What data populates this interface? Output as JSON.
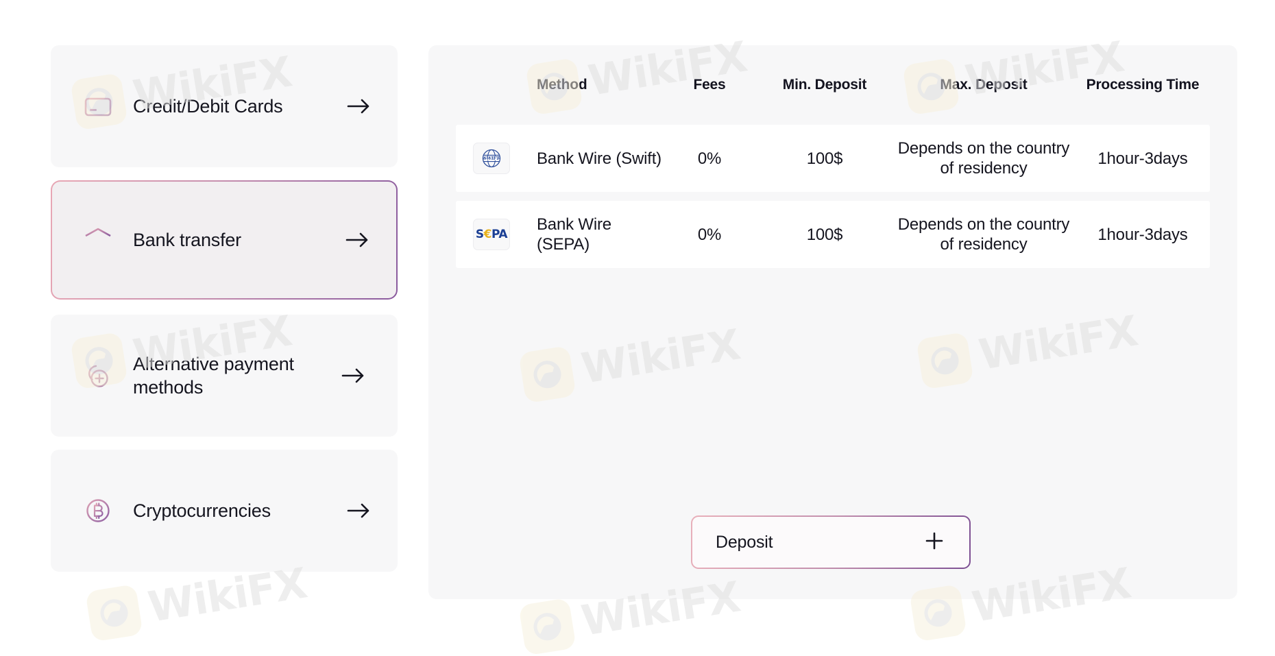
{
  "sidebar": {
    "items": [
      {
        "label": "Credit/Debit Cards",
        "icon": "credit-card-icon",
        "selected": false,
        "arrow": "→"
      },
      {
        "label": "Bank transfer",
        "icon": "bank-icon",
        "selected": true,
        "arrow": "→"
      },
      {
        "label": "Alternative payment methods",
        "icon": "alternative-payment-icon",
        "selected": false,
        "arrow": "→"
      },
      {
        "label": "Cryptocurrencies",
        "icon": "bitcoin-icon",
        "selected": false,
        "arrow": "→"
      }
    ]
  },
  "table": {
    "headers": {
      "logo": "",
      "method": "Method",
      "fees": "Fees",
      "min_deposit": "Min. Deposit",
      "max_deposit": "Max. Deposit",
      "processing_time": "Processing Time"
    },
    "rows": [
      {
        "logo": "swift-logo-icon",
        "logo_text": "SWIFT",
        "method": "Bank Wire (Swift)",
        "fees": "0%",
        "min_deposit": "100$",
        "max_deposit": "Depends on the country of residency",
        "processing_time": "1hour-3days"
      },
      {
        "logo": "sepa-logo-icon",
        "logo_text": "SEPA",
        "method": "Bank Wire (SEPA)",
        "fees": "0%",
        "min_deposit": "100$",
        "max_deposit": "Depends on the country of residency",
        "processing_time": "1hour-3days"
      }
    ]
  },
  "deposit_button": {
    "label": "Deposit",
    "icon": "plus-icon"
  },
  "watermark": {
    "text": "WikiFX",
    "logo": "wikifx-eagle-icon"
  },
  "colors": {
    "accent_pink": "#e8a7b4",
    "accent_purple": "#8a5a9e",
    "panel_bg": "#f7f7f8",
    "selected_bg": "#f2eff1",
    "row_bg": "#ffffff",
    "text": "#15151f",
    "swift_blue": "#2f4f9c",
    "sepa_blue": "#1b3f94",
    "sepa_gold": "#e8b21c"
  }
}
